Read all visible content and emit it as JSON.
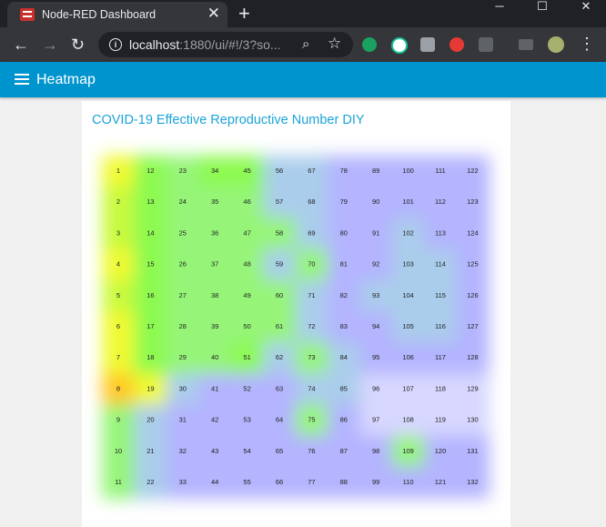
{
  "browser": {
    "tab_title": "Node-RED Dashboard",
    "new_tab": "+",
    "url_host": "localhost",
    "url_rest": ":1880/ui/#!/3?so...",
    "window_controls": [
      "─",
      "☐",
      "✕"
    ]
  },
  "app": {
    "title": "Heatmap",
    "card_title": "COVID-19 Effective Reproductive Number DIY",
    "accent_color": "#0094ce",
    "title_color": "#1ba4d8"
  },
  "heatmap": {
    "columns": 12,
    "rows": 11,
    "labels": [
      [
        "1",
        "12",
        "23",
        "34",
        "45",
        "56",
        "67",
        "78",
        "89",
        "100",
        "111",
        "122"
      ],
      [
        "2",
        "13",
        "24",
        "35",
        "46",
        "57",
        "68",
        "79",
        "90",
        "101",
        "112",
        "123"
      ],
      [
        "3",
        "14",
        "25",
        "36",
        "47",
        "58",
        "69",
        "80",
        "91",
        "102",
        "113",
        "124"
      ],
      [
        "4",
        "15",
        "26",
        "37",
        "48",
        "59",
        "70",
        "81",
        "92",
        "103",
        "114",
        "125"
      ],
      [
        "5",
        "16",
        "27",
        "38",
        "49",
        "60",
        "71",
        "82",
        "93",
        "104",
        "115",
        "126"
      ],
      [
        "6",
        "17",
        "28",
        "39",
        "50",
        "61",
        "72",
        "83",
        "94",
        "105",
        "116",
        "127"
      ],
      [
        "7",
        "18",
        "29",
        "40",
        "51",
        "62",
        "73",
        "84",
        "95",
        "106",
        "117",
        "128"
      ],
      [
        "8",
        "19",
        "30",
        "41",
        "52",
        "63",
        "74",
        "85",
        "96",
        "107",
        "118",
        "129"
      ],
      [
        "9",
        "20",
        "31",
        "42",
        "53",
        "64",
        "75",
        "86",
        "97",
        "108",
        "119",
        "130"
      ],
      [
        "10",
        "21",
        "32",
        "43",
        "54",
        "65",
        "76",
        "87",
        "98",
        "109",
        "120",
        "131"
      ],
      [
        "11",
        "22",
        "33",
        "44",
        "55",
        "66",
        "77",
        "88",
        "99",
        "110",
        "121",
        "132"
      ]
    ],
    "intensity": [
      [
        0.82,
        0.7,
        0.55,
        0.62,
        0.65,
        0.45,
        0.45,
        0.3,
        0.3,
        0.25,
        0.25,
        0.25
      ],
      [
        0.72,
        0.62,
        0.5,
        0.5,
        0.55,
        0.4,
        0.35,
        0.3,
        0.25,
        0.28,
        0.25,
        0.25
      ],
      [
        0.72,
        0.65,
        0.5,
        0.5,
        0.52,
        0.55,
        0.4,
        0.3,
        0.25,
        0.4,
        0.3,
        0.3
      ],
      [
        0.8,
        0.62,
        0.52,
        0.5,
        0.5,
        0.4,
        0.5,
        0.3,
        0.28,
        0.4,
        0.35,
        0.3
      ],
      [
        0.78,
        0.68,
        0.52,
        0.55,
        0.5,
        0.55,
        0.35,
        0.3,
        0.4,
        0.35,
        0.35,
        0.3
      ],
      [
        0.85,
        0.7,
        0.52,
        0.52,
        0.5,
        0.5,
        0.4,
        0.3,
        0.28,
        0.35,
        0.4,
        0.3
      ],
      [
        0.86,
        0.7,
        0.55,
        0.52,
        0.6,
        0.45,
        0.5,
        0.35,
        0.28,
        0.25,
        0.28,
        0.25
      ],
      [
        0.95,
        0.82,
        0.4,
        0.3,
        0.28,
        0.28,
        0.42,
        0.45,
        0.1,
        0.1,
        0.1,
        0.1
      ],
      [
        0.55,
        0.48,
        0.3,
        0.3,
        0.3,
        0.3,
        0.55,
        0.25,
        0.1,
        0.1,
        0.1,
        0.1
      ],
      [
        0.52,
        0.45,
        0.3,
        0.3,
        0.25,
        0.25,
        0.25,
        0.25,
        0.28,
        0.55,
        0.22,
        0.22
      ],
      [
        0.52,
        0.45,
        0.3,
        0.3,
        0.25,
        0.25,
        0.25,
        0.25,
        0.25,
        0.25,
        0.22,
        0.22
      ]
    ]
  }
}
